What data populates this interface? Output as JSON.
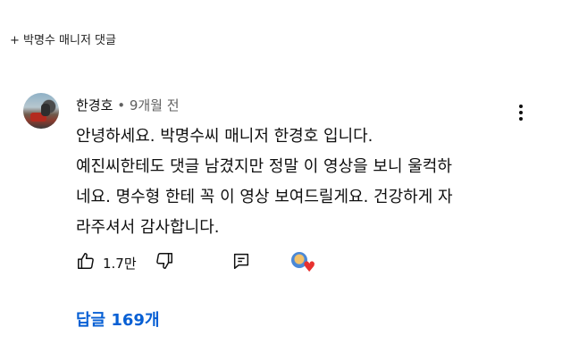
{
  "caption": "+ 박명수 매니저 댓글",
  "comment": {
    "author": "한경호",
    "time": "9개월 전",
    "lines": [
      "안녕하세요. 박명수씨 매니저 한경호 입니다.",
      "예진씨한테도 댓글 남겼지만 정말 이 영상을 보니 울컥하",
      "네요. 명수형 한테 꼭 이 영상 보여드릴게요. 건강하게 자",
      "라주셔서 감사합니다."
    ],
    "like_count": "1.7만",
    "replies_label": "답글 169개"
  },
  "icons": {
    "like": "thumbs-up-icon",
    "dislike": "thumbs-down-icon",
    "reply": "comment-icon",
    "more": "more-vertical-icon",
    "heart": "creator-heart-icon"
  },
  "colors": {
    "text": "#0f0f0f",
    "muted": "#606060",
    "link": "#065fd4",
    "heart": "#e8312f"
  }
}
